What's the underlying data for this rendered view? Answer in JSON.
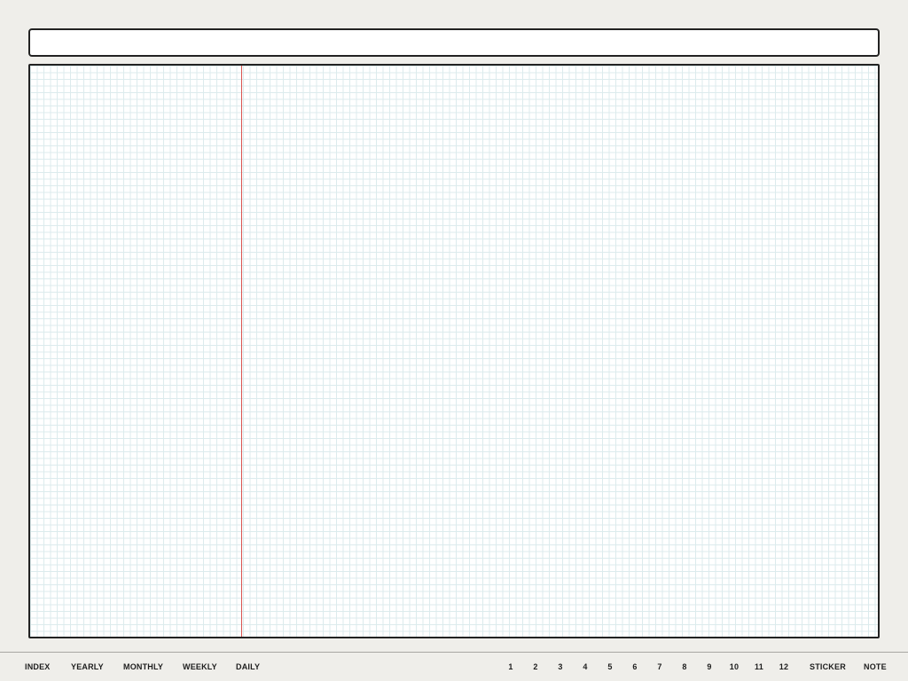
{
  "title_bar": {
    "value": ""
  },
  "left_nav": [
    {
      "label": "INDEX"
    },
    {
      "label": "YEARLY"
    },
    {
      "label": "MONTHLY"
    },
    {
      "label": "WEEKLY"
    },
    {
      "label": "DAILY"
    }
  ],
  "month_nav": [
    {
      "label": "1"
    },
    {
      "label": "2"
    },
    {
      "label": "3"
    },
    {
      "label": "4"
    },
    {
      "label": "5"
    },
    {
      "label": "6"
    },
    {
      "label": "7"
    },
    {
      "label": "8"
    },
    {
      "label": "9"
    },
    {
      "label": "10"
    },
    {
      "label": "11"
    },
    {
      "label": "12"
    }
  ],
  "right_nav": [
    {
      "label": "STICKER"
    },
    {
      "label": "NOTE"
    }
  ],
  "colors": {
    "background": "#efeeea",
    "page": "#ffffff",
    "grid": "#dcebed",
    "margin_line": "#d9534f",
    "border": "#222222",
    "text": "#1e1e1e"
  }
}
